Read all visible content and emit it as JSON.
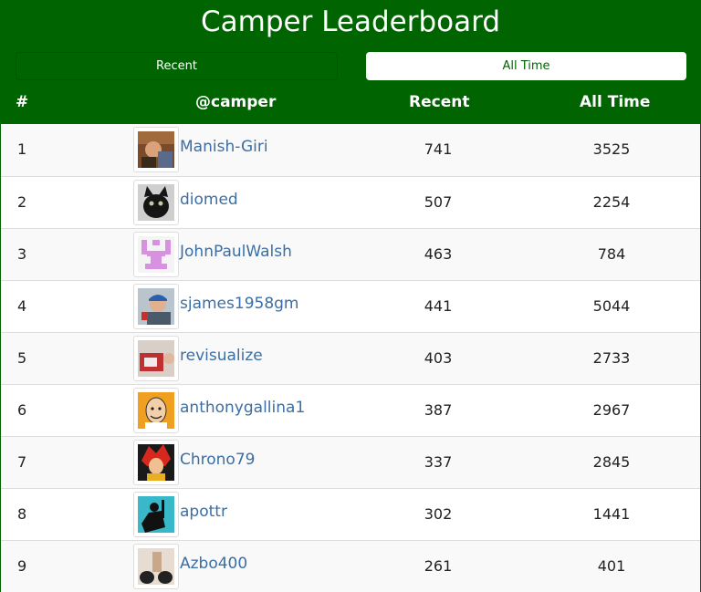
{
  "header": {
    "title": "Camper Leaderboard",
    "recent_button": "Recent",
    "alltime_button": "All Time",
    "columns": {
      "rank": "#",
      "camper": "@camper",
      "recent": "Recent",
      "alltime": "All Time"
    }
  },
  "colors": {
    "brand_green": "#006400",
    "link_blue": "#3a6ea5"
  },
  "rows": [
    {
      "rank": "1",
      "username": "Manish-Giri",
      "recent": "741",
      "alltime": "3525",
      "avatar": "photo-man-avatar"
    },
    {
      "rank": "2",
      "username": "diomed",
      "recent": "507",
      "alltime": "2254",
      "avatar": "black-cat-avatar"
    },
    {
      "rank": "3",
      "username": "JohnPaulWalsh",
      "recent": "463",
      "alltime": "784",
      "avatar": "identicon-avatar"
    },
    {
      "rank": "4",
      "username": "sjames1958gm",
      "recent": "441",
      "alltime": "5044",
      "avatar": "cap-man-avatar"
    },
    {
      "rank": "5",
      "username": "revisualize",
      "recent": "403",
      "alltime": "2733",
      "avatar": "sign-photo-avatar"
    },
    {
      "rank": "6",
      "username": "anthonygallina1",
      "recent": "387",
      "alltime": "2967",
      "avatar": "cartoon-man-avatar"
    },
    {
      "rank": "7",
      "username": "Chrono79",
      "recent": "337",
      "alltime": "2845",
      "avatar": "anime-red-hair-avatar"
    },
    {
      "rank": "8",
      "username": "apottr",
      "recent": "302",
      "alltime": "1441",
      "avatar": "silhouette-teal-avatar"
    },
    {
      "rank": "9",
      "username": "Azbo400",
      "recent": "261",
      "alltime": "401",
      "avatar": "hands-photo-avatar"
    }
  ]
}
